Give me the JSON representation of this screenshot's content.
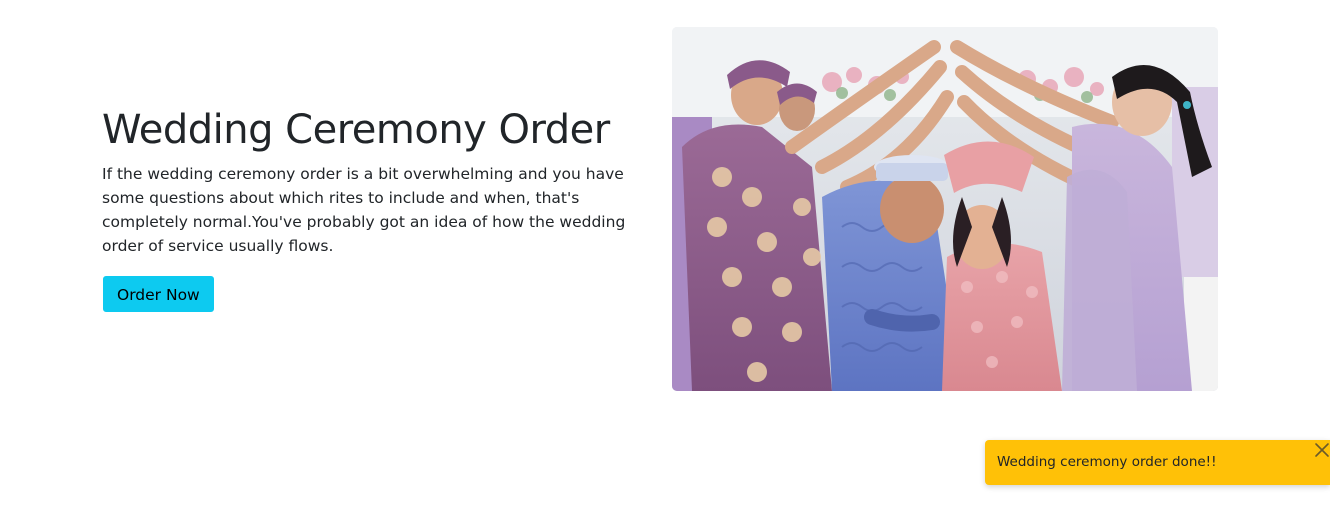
{
  "hero": {
    "title": "Wedding Ceremony Order",
    "description": "If the wedding ceremony order is a bit overwhelming and you have some questions about which rites to include and when, that's completely normal.You've probably got an idea of how the wedding order of service usually flows.",
    "order_button_label": "Order Now",
    "image_alt": "Wedding ceremony photo"
  },
  "toast": {
    "message": "Wedding ceremony order done!!",
    "close_icon": "close-icon"
  },
  "colors": {
    "accent": "#0dcaf0",
    "toast": "#ffc107",
    "text": "#212529"
  }
}
